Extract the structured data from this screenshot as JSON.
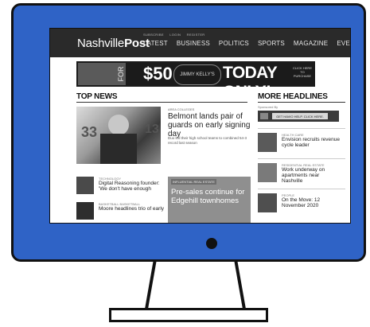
{
  "site": {
    "logo_light": "Nashville",
    "logo_bold": "Post",
    "util_links": [
      "SUBSCRIBE",
      "LOGIN",
      "REGISTER"
    ],
    "nav": [
      "LATEST",
      "BUSINESS",
      "POLITICS",
      "SPORTS",
      "MAGAZINE",
      "EVENTS"
    ]
  },
  "banner": {
    "label": "FOR",
    "amount": "$50",
    "brand": "JIMMY KELLY'S",
    "headline": "TODAY ONLY!",
    "cta": "CLICK HERE TO PURCHASE"
  },
  "top_news": {
    "title": "TOP NEWS",
    "feature": {
      "category": "AREA COLLEGES",
      "headline": "Belmont lands pair of guards on early signing day",
      "blurb": "Duo led their high school teams to combined 54-3 record last season",
      "jersey_left": "33",
      "jersey_right": "13"
    },
    "stories": [
      {
        "category": "TECHNOLOGY",
        "headline": "Digital Reasoning founder: 'We don't have enough"
      },
      {
        "category": "BASKETBALL BASKETBALL",
        "headline": "Moore headlines trio of early"
      }
    ],
    "promo": {
      "tag": "INFLUENTIAL REAL ESTATE",
      "headline": "Pre-sales continue for Edgehill townhomes"
    }
  },
  "more_headlines": {
    "title": "MORE HEADLINES",
    "sponsored_label": "Sponsored By",
    "sponsor_button": "GET HAVIO HELP. CLICK HERE.",
    "items": [
      {
        "category": "HEALTH CARE",
        "headline": "Envision recruits revenue cycle leader"
      },
      {
        "category": "RESIDENTIAL REAL ESTATE",
        "headline": "Work underway on apartments near Nashville"
      },
      {
        "category": "PEOPLE",
        "headline": "On the Move: 12 November 2020"
      }
    ]
  }
}
